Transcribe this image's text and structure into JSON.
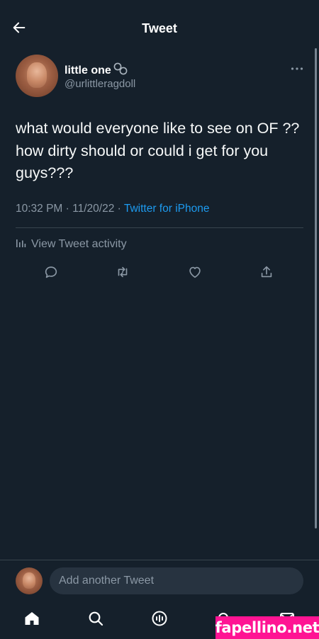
{
  "header": {
    "title": "Tweet"
  },
  "tweet": {
    "author": {
      "display_name": "little one",
      "handle": "@urlittleragdoll"
    },
    "text": "what would everyone like to see on OF ?? how dirty should or could i get for you guys???",
    "time": "10:32 PM",
    "separator": "·",
    "date": "11/20/22",
    "client": "Twitter for iPhone"
  },
  "activity": {
    "label": "View Tweet activity"
  },
  "reply": {
    "placeholder": "Add another Tweet"
  },
  "watermark": {
    "text": "fapellino.net"
  },
  "colors": {
    "background": "#15202b",
    "accent": "#1d9bf0",
    "muted_text": "#8b98a5",
    "divider": "#38444d",
    "watermark": "#ff1493"
  },
  "icons": {
    "back": "arrow-left-icon",
    "more": "more-horizontal-icon",
    "name_emoji": "handcuffs-icon",
    "activity": "bar-chart-icon",
    "reply": "reply-icon",
    "retweet": "retweet-icon",
    "like": "heart-icon",
    "share": "share-icon",
    "home": "home-icon",
    "search": "search-icon",
    "spaces": "spaces-icon",
    "notifications": "bell-icon",
    "messages": "mail-icon"
  }
}
